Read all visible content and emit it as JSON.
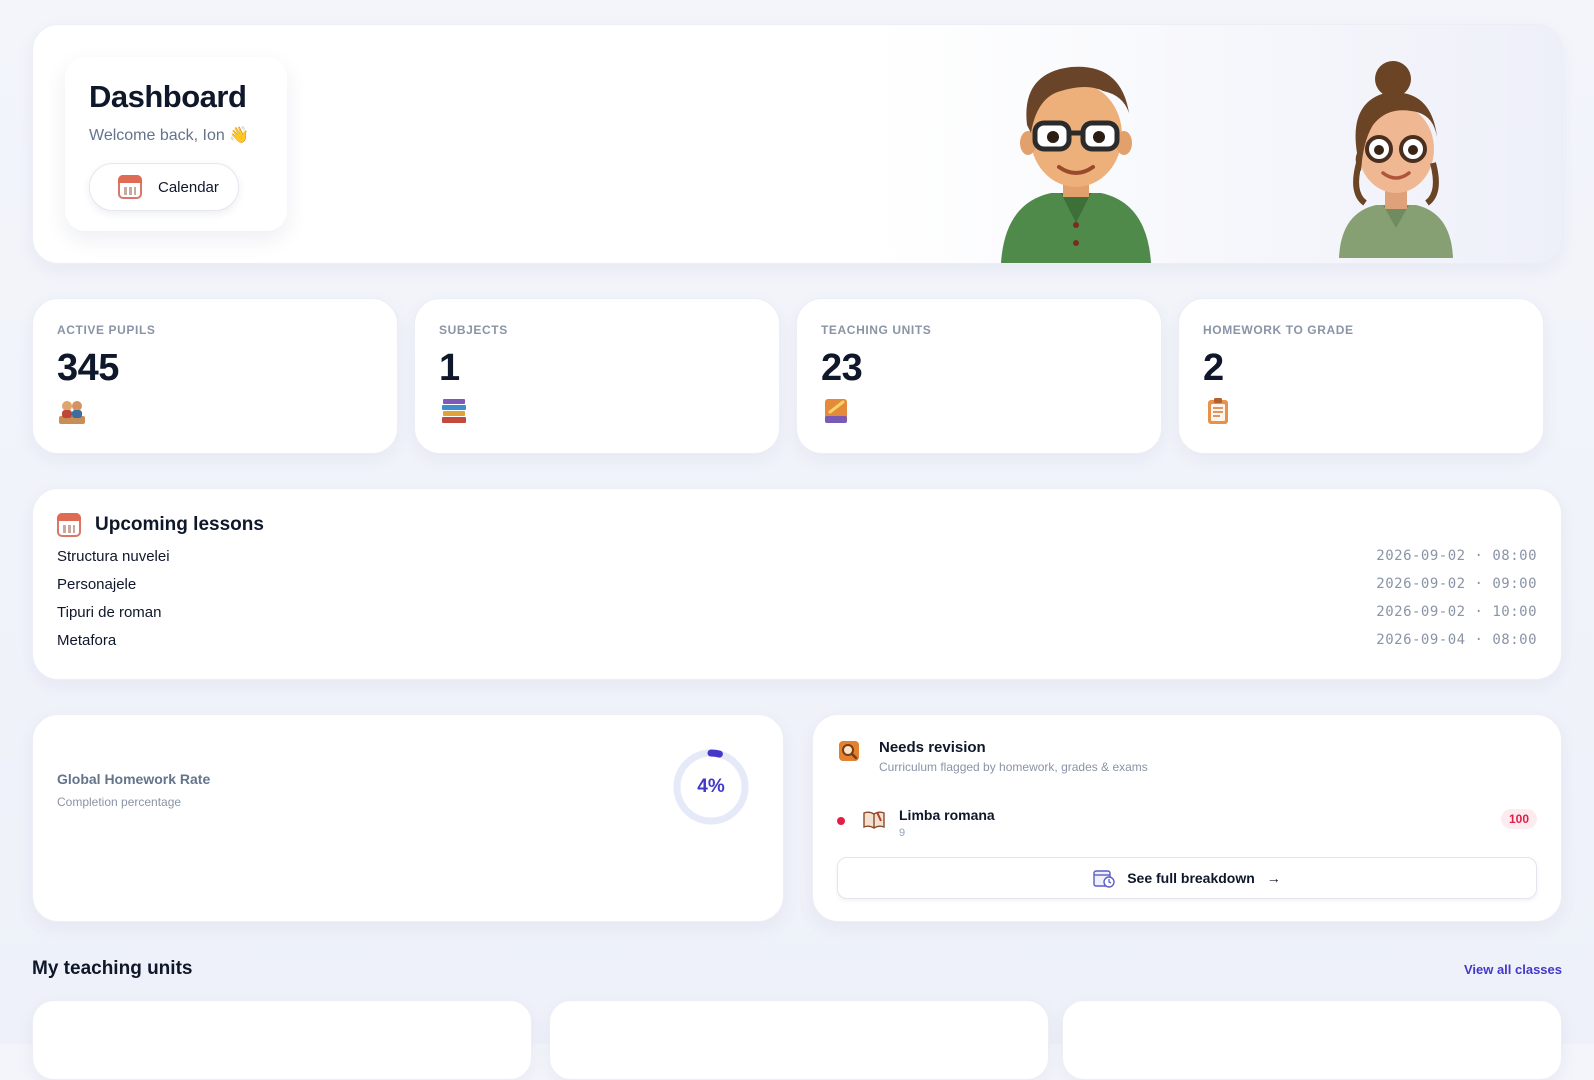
{
  "hero": {
    "title": "Dashboard",
    "welcome": "Welcome back, Ion 👋",
    "calendar_label": "Calendar"
  },
  "stats": [
    {
      "label": "ACTIVE PUPILS",
      "value": "345",
      "icon": "pupils-icon"
    },
    {
      "label": "SUBJECTS",
      "value": "1",
      "icon": "books-icon"
    },
    {
      "label": "TEACHING UNITS",
      "value": "23",
      "icon": "notebook-icon"
    },
    {
      "label": "HOMEWORK TO GRADE",
      "value": "2",
      "icon": "clipboard-icon"
    }
  ],
  "lessons": {
    "title": "Upcoming lessons",
    "items": [
      {
        "name": "Structura nuvelei",
        "time": "2026-09-02 · 08:00"
      },
      {
        "name": "Personajele",
        "time": "2026-09-02 · 09:00"
      },
      {
        "name": "Tipuri de roman",
        "time": "2026-09-02 · 10:00"
      },
      {
        "name": "Metafora",
        "time": "2026-09-04 · 08:00"
      }
    ]
  },
  "homework_rate": {
    "title": "Global Homework Rate",
    "subtitle": "Completion percentage",
    "value_label": "4%",
    "fraction": 0.04
  },
  "revision": {
    "title": "Needs revision",
    "subtitle": "Curriculum flagged by homework, grades & exams",
    "item": {
      "name": "Limba romana",
      "grade": "9",
      "score": "100"
    },
    "breakdown_label": "See full breakdown"
  },
  "units": {
    "title": "My teaching units",
    "view_all": "View all classes"
  },
  "colors": {
    "accent": "#4338ca",
    "danger": "#e11d48",
    "ring_track": "#e6e9f8"
  }
}
